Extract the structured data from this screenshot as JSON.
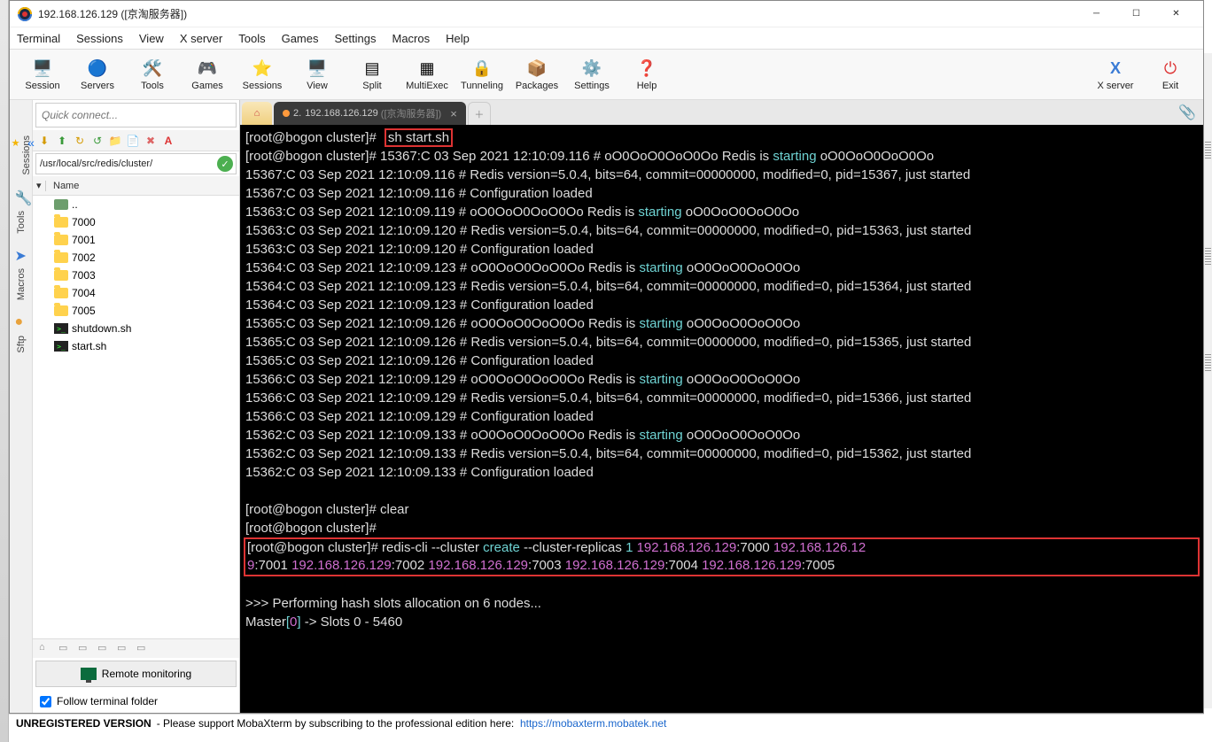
{
  "window": {
    "title": "192.168.126.129 ([京淘服务器])"
  },
  "menu": {
    "terminal": "Terminal",
    "sessions": "Sessions",
    "view": "View",
    "xserver": "X server",
    "tools": "Tools",
    "games": "Games",
    "settings": "Settings",
    "macros": "Macros",
    "help": "Help"
  },
  "toolbar": {
    "session": "Session",
    "servers": "Servers",
    "tools": "Tools",
    "games": "Games",
    "sessions": "Sessions",
    "view": "View",
    "split": "Split",
    "multiexec": "MultiExec",
    "tunneling": "Tunneling",
    "packages": "Packages",
    "settings": "Settings",
    "help": "Help",
    "xserver": "X server",
    "exit": "Exit"
  },
  "quick_connect_placeholder": "Quick connect...",
  "side_tabs": {
    "sessions": "Sessions",
    "tools": "Tools",
    "macros": "Macros",
    "sftp": "Sftp"
  },
  "sftp": {
    "path": "/usr/local/src/redis/cluster/",
    "name_header": "Name",
    "items": [
      {
        "name": "..",
        "type": "up"
      },
      {
        "name": "7000",
        "type": "folder"
      },
      {
        "name": "7001",
        "type": "folder"
      },
      {
        "name": "7002",
        "type": "folder"
      },
      {
        "name": "7003",
        "type": "folder"
      },
      {
        "name": "7004",
        "type": "folder"
      },
      {
        "name": "7005",
        "type": "folder"
      },
      {
        "name": "shutdown.sh",
        "type": "sh"
      },
      {
        "name": "start.sh",
        "type": "sh"
      }
    ]
  },
  "remote_monitoring": "Remote monitoring",
  "follow_terminal": "Follow terminal folder",
  "tabs": {
    "active_num": "2.",
    "active_host": "192.168.126.129",
    "active_suffix": "([京淘服务器])"
  },
  "term": {
    "prompt": "[root@bogon cluster]#",
    "cmd1": "sh start.sh",
    "starting": "starting",
    "l1": " 15367:C 03 Sep 2021 12:10:09.116 # oO0OoO0OoO0Oo Redis is ",
    "l1b": " oO0OoO0OoO0Oo",
    "l2": "15367:C 03 Sep 2021 12:10:09.116 # Redis version=5.0.4, bits=64, commit=00000000, modified=0, pid=15367, just started",
    "l3": "15367:C 03 Sep 2021 12:10:09.116 # Configuration loaded",
    "l4": "15363:C 03 Sep 2021 12:10:09.119 # oO0OoO0OoO0Oo Redis is ",
    "l4b": " oO0OoO0OoO0Oo",
    "l5": "15363:C 03 Sep 2021 12:10:09.120 # Redis version=5.0.4, bits=64, commit=00000000, modified=0, pid=15363, just started",
    "l6": "15363:C 03 Sep 2021 12:10:09.120 # Configuration loaded",
    "l7": "15364:C 03 Sep 2021 12:10:09.123 # oO0OoO0OoO0Oo Redis is ",
    "l7b": " oO0OoO0OoO0Oo",
    "l8": "15364:C 03 Sep 2021 12:10:09.123 # Redis version=5.0.4, bits=64, commit=00000000, modified=0, pid=15364, just started",
    "l9": "15364:C 03 Sep 2021 12:10:09.123 # Configuration loaded",
    "l10": "15365:C 03 Sep 2021 12:10:09.126 # oO0OoO0OoO0Oo Redis is ",
    "l10b": " oO0OoO0OoO0Oo",
    "l11": "15365:C 03 Sep 2021 12:10:09.126 # Redis version=5.0.4, bits=64, commit=00000000, modified=0, pid=15365, just started",
    "l12": "15365:C 03 Sep 2021 12:10:09.126 # Configuration loaded",
    "l13": "15366:C 03 Sep 2021 12:10:09.129 # oO0OoO0OoO0Oo Redis is ",
    "l13b": " oO0OoO0OoO0Oo",
    "l14": "15366:C 03 Sep 2021 12:10:09.129 # Redis version=5.0.4, bits=64, commit=00000000, modified=0, pid=15366, just started",
    "l15": "15366:C 03 Sep 2021 12:10:09.129 # Configuration loaded",
    "l16": "15362:C 03 Sep 2021 12:10:09.133 # oO0OoO0OoO0Oo Redis is ",
    "l16b": " oO0OoO0OoO0Oo",
    "l17": "15362:C 03 Sep 2021 12:10:09.133 # Redis version=5.0.4, bits=64, commit=00000000, modified=0, pid=15362, just started",
    "l18": "15362:C 03 Sep 2021 12:10:09.133 # Configuration loaded",
    "blank": "",
    "clear": " clear",
    "cmd2a": " redis-cli --cluster ",
    "create": "create",
    "cmd2b": " --cluster-replicas ",
    "one": "1",
    "sp": " ",
    "ip": "192.168.126.129",
    "p0": ":7000 ",
    "ip2": "192.168.126.12",
    "nine": "9",
    "p1": ":7001 ",
    "p2": ":7002 ",
    "p3": ":7003 ",
    "p4": ":7004 ",
    "p5": ":7005",
    "perf": ">>> Performing hash slots allocation on 6 nodes...",
    "master_a": "Master",
    "master_b": "[",
    "master_c": "0",
    "master_d": "]",
    "master_e": " -> Slots 0 - 5460"
  },
  "status": {
    "unreg": "UNREGISTERED VERSION",
    "msg": "- Please support MobaXterm by subscribing to the professional edition here:",
    "url": "https://mobaxterm.mobatek.net"
  }
}
